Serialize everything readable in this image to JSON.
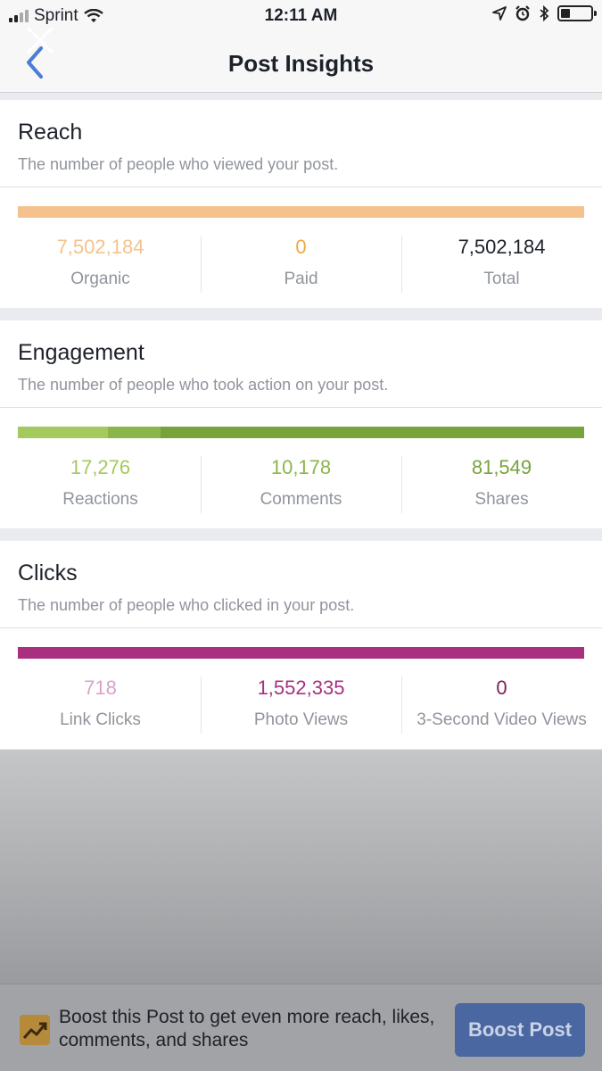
{
  "status_bar": {
    "carrier": "Sprint",
    "time": "12:11 AM",
    "icons": [
      "signal-icon",
      "wifi-icon",
      "location-icon",
      "alarm-icon",
      "bluetooth-icon",
      "battery-icon"
    ]
  },
  "nav": {
    "title": "Post Insights",
    "icons": [
      "back-chevron-icon",
      "close-icon"
    ]
  },
  "sections": {
    "reach": {
      "title": "Reach",
      "description": "The number of people who viewed your post.",
      "bar_colors": [
        "#f5c28d"
      ],
      "metrics": [
        {
          "value": "7,502,184",
          "label": "Organic",
          "color": "#f5c28d"
        },
        {
          "value": "0",
          "label": "Paid",
          "color": "#f0a84a"
        },
        {
          "value": "7,502,184",
          "label": "Total",
          "color": "#1d2129"
        }
      ]
    },
    "engagement": {
      "title": "Engagement",
      "description": "The number of people who took action on your post.",
      "bar_colors": [
        "#a4c95f",
        "#8cb54b",
        "#78a33a"
      ],
      "bar_shares": [
        0.1585,
        0.0934,
        0.7481
      ],
      "metrics": [
        {
          "value": "17,276",
          "label": "Reactions",
          "color": "#a4c95f"
        },
        {
          "value": "10,178",
          "label": "Comments",
          "color": "#8cb54b"
        },
        {
          "value": "81,549",
          "label": "Shares",
          "color": "#78a33a"
        }
      ]
    },
    "clicks": {
      "title": "Clicks",
      "description": "The number of people who clicked in your post.",
      "bar_colors": [
        "#a8307e"
      ],
      "metrics": [
        {
          "value": "718",
          "label": "Link Clicks",
          "color": "#dba2c8"
        },
        {
          "value": "1,552,335",
          "label": "Photo Views",
          "color": "#a8307e"
        },
        {
          "value": "0",
          "label": "3-Second Video Views",
          "color": "#7a1f5c"
        }
      ]
    }
  },
  "boost": {
    "message": "Boost this Post to get even more reach, likes, comments, and shares",
    "button_label": "Boost Post",
    "icon": "trending-up-icon",
    "button_color": "#4b67a1"
  }
}
